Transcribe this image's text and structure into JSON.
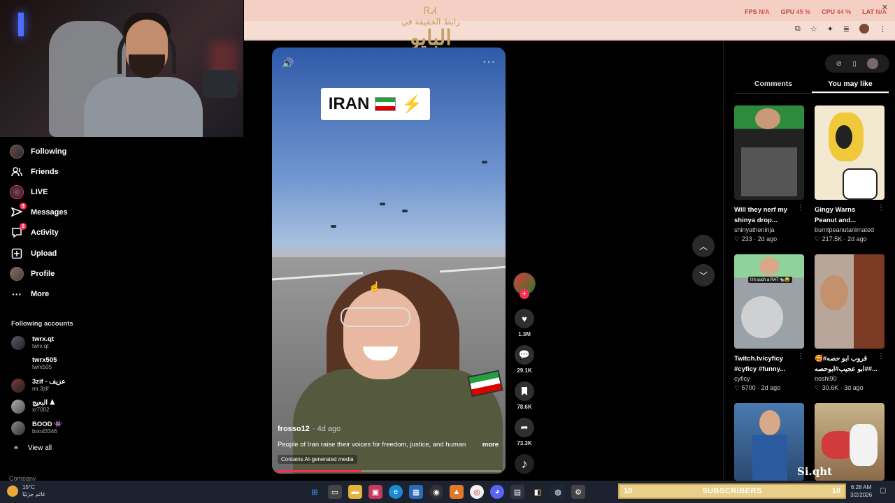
{
  "overlay": {
    "fps_label": "FPS",
    "fps_value": "N/A",
    "gpu_label": "GPU",
    "gpu_value": "45 %",
    "cpu_label": "CPU",
    "cpu_value": "44 %",
    "lat_label": "LAT",
    "lat_value": "N/A"
  },
  "logo": {
    "mark": "ᏒᏗ",
    "small": "رابط الحقيقة في",
    "big": "البايو"
  },
  "sidebar": {
    "nav": [
      {
        "label": "Following",
        "icon": "avatar-icon"
      },
      {
        "label": "Friends",
        "icon": "friends-icon"
      },
      {
        "label": "LIVE",
        "icon": "live-icon"
      },
      {
        "label": "Messages",
        "icon": "send-icon",
        "badge": "3"
      },
      {
        "label": "Activity",
        "icon": "activity-icon",
        "badge": "3"
      },
      {
        "label": "Upload",
        "icon": "plus-square-icon"
      },
      {
        "label": "Profile",
        "icon": "profile-icon"
      },
      {
        "label": "More",
        "icon": "more-dots-icon"
      }
    ],
    "following_title": "Following accounts",
    "accounts": [
      {
        "name": "twrx.qt",
        "handle": "twrx.qt"
      },
      {
        "name": "twrx505",
        "handle": "twrx505"
      },
      {
        "name": "3zif - عزيف",
        "handle": "mr.3zif"
      },
      {
        "name": "البعيج ♟",
        "handle": "xr7002"
      },
      {
        "name": "BOOD 👾",
        "handle": "bood3346"
      }
    ],
    "view_all": "View all",
    "company": "Company"
  },
  "video": {
    "overlay_text": "IRAN",
    "author": "frosso12",
    "ago": "· 4d ago",
    "caption": "People of Iran raise their voices for freedom, justice, and human",
    "more": "more",
    "ai_tag": "Contains AI-generated media",
    "progress": 0.38
  },
  "actions": {
    "likes": "1.3M",
    "comments": "29.1K",
    "saves": "78.6K",
    "shares": "73.3K"
  },
  "right": {
    "tabs": [
      "Comments",
      "You may like"
    ],
    "cards": [
      {
        "title": "Will they nerf my shinya drop...",
        "author": "shinyatheninja",
        "likes": "233",
        "ago": "· 2d ago"
      },
      {
        "title": "Gingy Warns Peanut and...",
        "author": "burntpeanutanimated",
        "likes": "217.5K",
        "ago": "· 2d ago"
      },
      {
        "title": "Twitch.tv/cyficy #cyficy #funny...",
        "author": "cyficy",
        "likes": "5700",
        "ago": "· 2d ago"
      },
      {
        "title": "قروب ابو حصه#🥰 #ابو عجيب#ابوحصه#...",
        "author": "noshl90",
        "likes": "30.6K",
        "ago": "· 3d ago"
      }
    ],
    "thumb_label": "I'm such a RAT 🐀😂",
    "watermark": "Si.qht"
  },
  "taskbar": {
    "temp": "15°C",
    "weather_text": "غائم جزئيًا",
    "subs_left": "10",
    "subs_label": "SUBSCRIBERS",
    "subs_right": "10",
    "time": "6:28 AM",
    "date": "3/2/2026"
  }
}
